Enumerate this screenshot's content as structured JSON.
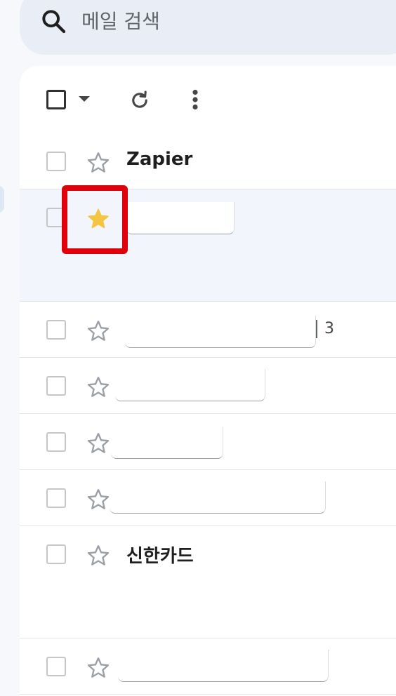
{
  "search": {
    "placeholder": "메일 검색",
    "icon": "search-icon"
  },
  "toolbar": {
    "select_all_icon": "checkbox-icon",
    "select_menu_icon": "caret-down-icon",
    "refresh_icon": "refresh-icon",
    "more_icon": "more-vert-icon"
  },
  "rows": [
    {
      "sender": "Zapier",
      "starred": false
    },
    {
      "sender": "",
      "starred": true,
      "selected": true
    },
    {
      "sender": "",
      "starred": false,
      "count": "3"
    },
    {
      "sender": "",
      "starred": false
    },
    {
      "sender": "",
      "starred": false
    },
    {
      "sender": "",
      "starred": false
    },
    {
      "sender": "신한카드",
      "starred": false
    },
    {
      "sender": "",
      "starred": false
    }
  ],
  "colors": {
    "starred": "#f4c542",
    "unstarred": "#9aa0a6",
    "highlight": "#e0000b"
  }
}
